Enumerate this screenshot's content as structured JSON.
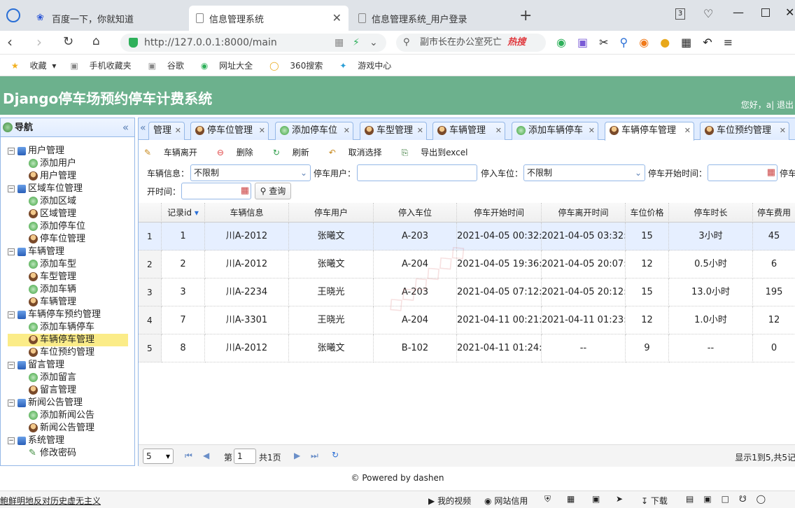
{
  "browser": {
    "tabs": [
      {
        "label": "百度一下，你就知道",
        "active": false
      },
      {
        "label": "信息管理系统",
        "active": true
      },
      {
        "label": "信息管理系统_用户登录",
        "active": false
      }
    ],
    "tab_count": "3",
    "url": "http://127.0.0.1:8000/main",
    "search_text": "副市长在办公室死亡",
    "hot_label": "热搜",
    "bookmarks": [
      "收藏",
      "手机收藏夹",
      "谷歌",
      "网址大全",
      "360搜索",
      "游戏中心"
    ]
  },
  "app": {
    "title": "Django停车场预约停车计费系统",
    "greeting": "您好，a| 退出"
  },
  "sidebar": {
    "title": "导航",
    "collapse_icon": "«",
    "items": [
      {
        "label": "用户管理",
        "level": 0
      },
      {
        "label": "添加用户",
        "level": 1,
        "icon": "add"
      },
      {
        "label": "用户管理",
        "level": 1,
        "icon": "user"
      },
      {
        "label": "区域车位管理",
        "level": 0
      },
      {
        "label": "添加区域",
        "level": 1,
        "icon": "add"
      },
      {
        "label": "区域管理",
        "level": 1,
        "icon": "user"
      },
      {
        "label": "添加停车位",
        "level": 1,
        "icon": "add"
      },
      {
        "label": "停车位管理",
        "level": 1,
        "icon": "user"
      },
      {
        "label": "车辆管理",
        "level": 0
      },
      {
        "label": "添加车型",
        "level": 1,
        "icon": "add"
      },
      {
        "label": "车型管理",
        "level": 1,
        "icon": "user"
      },
      {
        "label": "添加车辆",
        "level": 1,
        "icon": "add"
      },
      {
        "label": "车辆管理",
        "level": 1,
        "icon": "user"
      },
      {
        "label": "车辆停车预约管理",
        "level": 0
      },
      {
        "label": "添加车辆停车",
        "level": 1,
        "icon": "add"
      },
      {
        "label": "车辆停车管理",
        "level": 1,
        "icon": "user",
        "selected": true
      },
      {
        "label": "车位预约管理",
        "level": 1,
        "icon": "user"
      },
      {
        "label": "留言管理",
        "level": 0
      },
      {
        "label": "添加留言",
        "level": 1,
        "icon": "add"
      },
      {
        "label": "留言管理",
        "level": 1,
        "icon": "user"
      },
      {
        "label": "新闻公告管理",
        "level": 0
      },
      {
        "label": "添加新闻公告",
        "level": 1,
        "icon": "add"
      },
      {
        "label": "新闻公告管理",
        "level": 1,
        "icon": "user"
      },
      {
        "label": "系统管理",
        "level": 0
      },
      {
        "label": "修改密码",
        "level": 1,
        "icon": "pencil"
      }
    ]
  },
  "panel_tabs": [
    {
      "label": "管理",
      "icon": "none"
    },
    {
      "label": "停车位管理",
      "icon": "user"
    },
    {
      "label": "添加停车位",
      "icon": "add"
    },
    {
      "label": "车型管理",
      "icon": "user"
    },
    {
      "label": "车辆管理",
      "icon": "user"
    },
    {
      "label": "添加车辆停车",
      "icon": "add"
    },
    {
      "label": "车辆停车管理",
      "icon": "user",
      "active": true
    },
    {
      "label": "车位预约管理",
      "icon": "user"
    }
  ],
  "toolbar": {
    "leave": "车辆离开",
    "delete": "删除",
    "refresh": "刷新",
    "cancel": "取消选择",
    "export": "导出到excel"
  },
  "filters": {
    "car_label": "车辆信息：",
    "car_value": "不限制",
    "user_label": "停车用户：",
    "spot_label": "停入车位：",
    "spot_value": "不限制",
    "start_label": "停车开始时间：",
    "end_label_part1": "停车",
    "end_label_part2": "开时间：",
    "query": "查询"
  },
  "grid": {
    "columns": [
      "",
      "记录id",
      "车辆信息",
      "停车用户",
      "停入车位",
      "停车开始时间",
      "停车离开时间",
      "车位价格",
      "停车时长",
      "停车费用"
    ],
    "rows": [
      [
        "1",
        "1",
        "川A-2012",
        "张曦文",
        "A-203",
        "2021-04-05 00:32:",
        "2021-04-05 03:32:",
        "15",
        "3小时",
        "45"
      ],
      [
        "2",
        "2",
        "川A-2012",
        "张曦文",
        "A-204",
        "2021-04-05 19:36:",
        "2021-04-05 20:07:",
        "12",
        "0.5小时",
        "6"
      ],
      [
        "3",
        "3",
        "川A-2234",
        "王晓光",
        "A-203",
        "2021-04-05 07:12:",
        "2021-04-05 20:12:",
        "15",
        "13.0小时",
        "195"
      ],
      [
        "4",
        "7",
        "川A-3301",
        "王晓光",
        "A-204",
        "2021-04-11 00:21:",
        "2021-04-11 01:23:",
        "12",
        "1.0小时",
        "12"
      ],
      [
        "5",
        "8",
        "川A-2012",
        "张曦文",
        "B-102",
        "2021-04-11 01:24:",
        "--",
        "9",
        "--",
        "0"
      ]
    ]
  },
  "pager": {
    "page_size": "5",
    "page_prefix": "第",
    "page_value": "1",
    "page_total": "共1页",
    "summary": "显示1到5,共5记"
  },
  "footer": "© Powered by dashen",
  "statusbar": {
    "left": "鲍鲜明地反对历史虚无主义",
    "video": "我的视频",
    "credit": "网站信用",
    "download": "下载"
  }
}
